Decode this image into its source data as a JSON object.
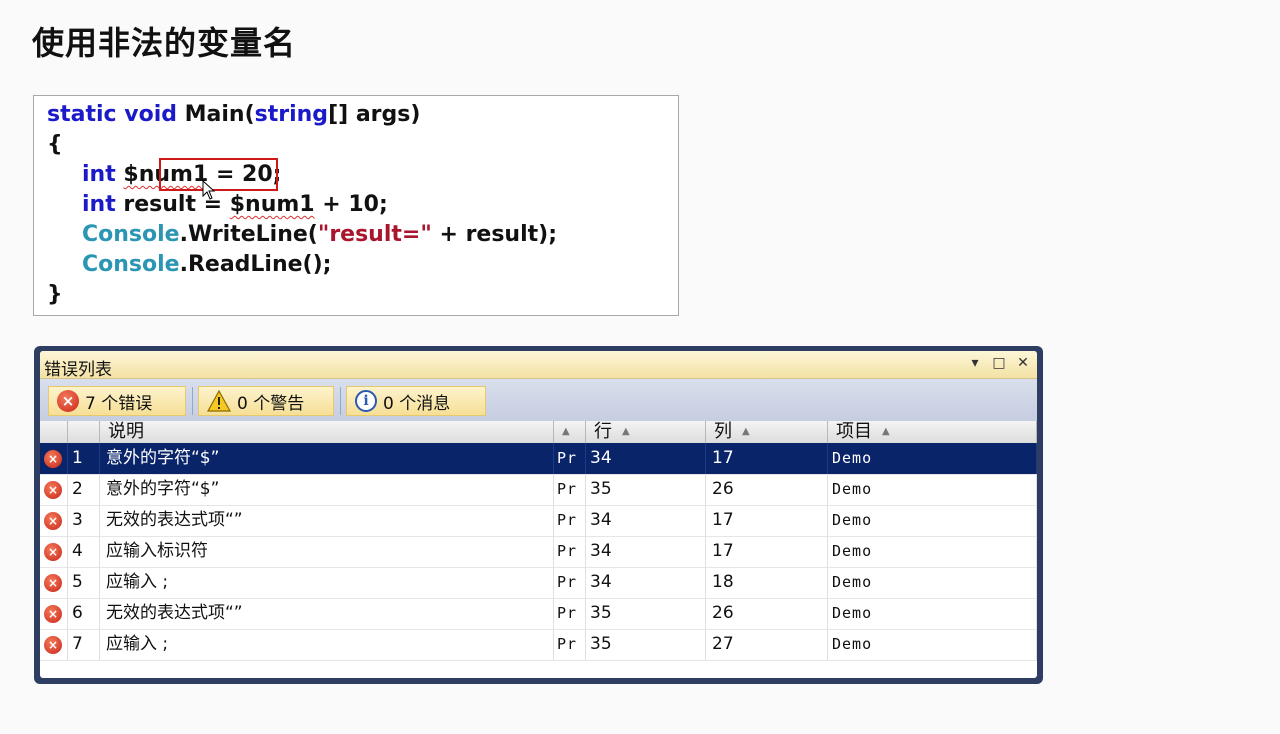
{
  "slide": {
    "title": "使用非法的变量名"
  },
  "code": {
    "line1": {
      "kw1": "static",
      "kw2": "void",
      "name": " Main(",
      "kw3": "string",
      "rest": "[] args)"
    },
    "line2": "{",
    "line3": {
      "kw": "int",
      "var": "$num1",
      "rest": " = 20;"
    },
    "line4": {
      "kw": "int",
      "mid": " result = ",
      "var": "$num1",
      "rest": " + 10;"
    },
    "line5": {
      "cls": "Console",
      "mid": ".WriteLine(",
      "str": "\"result=\"",
      "rest": " + result);"
    },
    "line6": {
      "cls": "Console",
      "rest": ".ReadLine();"
    },
    "line7": "}"
  },
  "error_list": {
    "title": "错误列表",
    "controls": {
      "dropdown": "▾",
      "restore": "□",
      "close": "✕"
    },
    "toolbar": {
      "errors": "7 个错误",
      "warnings": "0 个警告",
      "messages": "0 个消息"
    },
    "columns": {
      "description": "说明",
      "line": "行",
      "column": "列",
      "project": "项目"
    },
    "rows": [
      {
        "num": "1",
        "desc": "意外的字符“$”",
        "file": "Pr",
        "line": "34",
        "col": "17",
        "project": "Demo"
      },
      {
        "num": "2",
        "desc": "意外的字符“$”",
        "file": "Pr",
        "line": "35",
        "col": "26",
        "project": "Demo"
      },
      {
        "num": "3",
        "desc": "无效的表达式项“”",
        "file": "Pr",
        "line": "34",
        "col": "17",
        "project": "Demo"
      },
      {
        "num": "4",
        "desc": "应输入标识符",
        "file": "Pr",
        "line": "34",
        "col": "17",
        "project": "Demo"
      },
      {
        "num": "5",
        "desc": "应输入 ;",
        "file": "Pr",
        "line": "34",
        "col": "18",
        "project": "Demo"
      },
      {
        "num": "6",
        "desc": "无效的表达式项“”",
        "file": "Pr",
        "line": "35",
        "col": "26",
        "project": "Demo"
      },
      {
        "num": "7",
        "desc": "应输入 ;",
        "file": "Pr",
        "line": "35",
        "col": "27",
        "project": "Demo"
      }
    ],
    "error_icon_glyph": "×",
    "colors": {
      "selected_row": "#0a246a",
      "panel_frame": "#2d3e62",
      "keyword": "#1a1ac8",
      "class": "#2a96b4",
      "string": "#a8152c"
    }
  }
}
